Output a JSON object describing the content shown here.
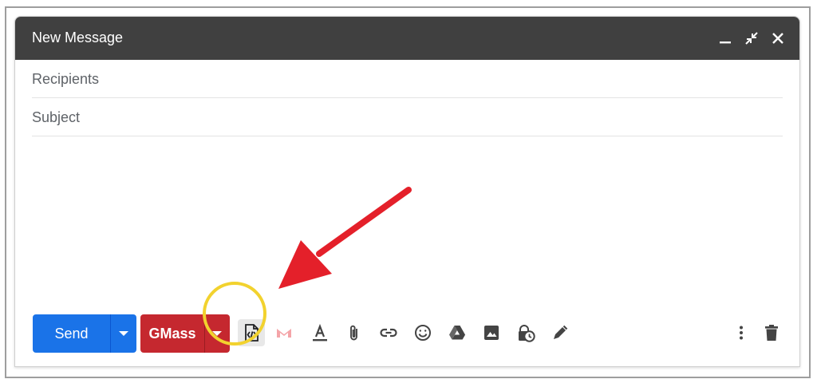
{
  "compose": {
    "title": "New Message",
    "recipients_placeholder": "Recipients",
    "subject_placeholder": "Subject"
  },
  "buttons": {
    "send_label": "Send",
    "gmass_label": "GMass"
  },
  "toolbar_icons": [
    "html-code-icon",
    "gmass-logo-icon",
    "format-text-icon",
    "attach-icon",
    "link-icon",
    "emoji-icon",
    "drive-icon",
    "image-icon",
    "confidential-mode-icon",
    "signature-icon",
    "more-options-icon",
    "trash-icon"
  ],
  "colors": {
    "header": "#404040",
    "send": "#1a73e8",
    "gmass": "#c5282f",
    "highlight": "#f2d22e",
    "arrow": "#e4202a"
  }
}
